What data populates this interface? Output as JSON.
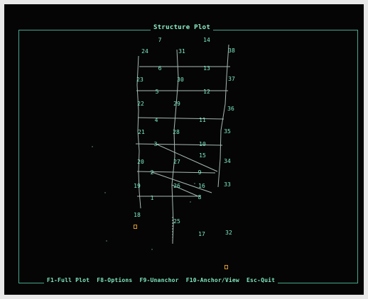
{
  "window": {
    "title": "Structure Plot"
  },
  "function_bar": {
    "items": [
      {
        "key": "F1",
        "label": "F1-Full Plot"
      },
      {
        "key": "F8",
        "label": "F8-Options"
      },
      {
        "key": "F9",
        "label": "F9-Unanchor"
      },
      {
        "key": "F10",
        "label": "F10-Anchor/View"
      },
      {
        "key": "Esc",
        "label": "Esc-Quit"
      }
    ]
  },
  "plot": {
    "node_labels": {
      "n1": "1",
      "n2": "2",
      "n3": "3",
      "n4": "4",
      "n5": "5",
      "n6": "6",
      "n7": "7",
      "n8": "8",
      "n9": "9",
      "n10": "10",
      "n11": "11",
      "n12": "12",
      "n13": "13",
      "n14": "14",
      "n15": "15",
      "n16": "16",
      "n17": "17",
      "n18": "18",
      "n19": "19",
      "n20": "20",
      "n21": "21",
      "n22": "22",
      "n23": "23",
      "n24": "24",
      "n25": "25",
      "n26": "26",
      "n27": "27",
      "n28": "28",
      "n29": "29",
      "n30": "30",
      "n31": "31",
      "n32": "32",
      "n33": "33",
      "n34": "34",
      "n35": "35",
      "n36": "36",
      "n37": "37",
      "n38": "38"
    },
    "colors": {
      "background": "#050505",
      "frame": "#46a88e",
      "members": "#cfe8e0",
      "labels": "#7ff0c8",
      "support_marker": "#d89a38"
    }
  }
}
